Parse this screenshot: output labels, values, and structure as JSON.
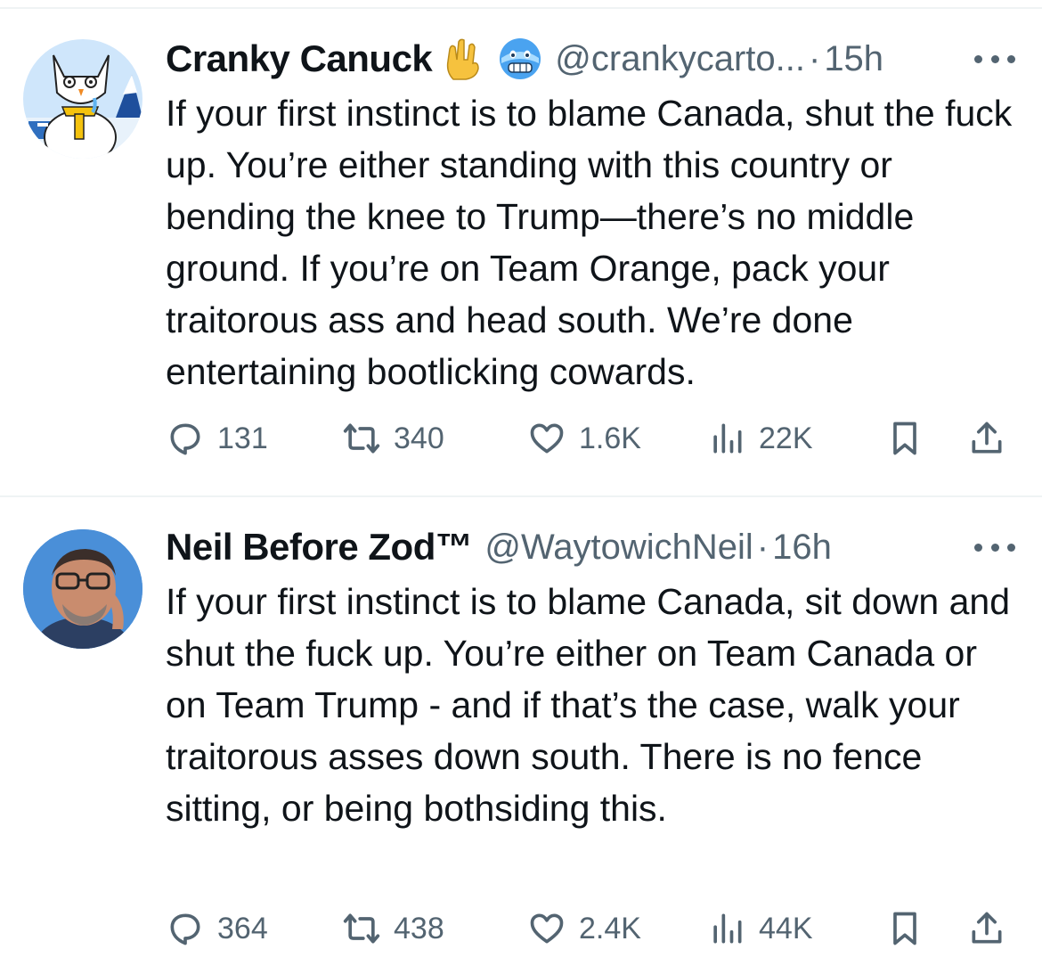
{
  "tweets": [
    {
      "name": "Cranky Canuck",
      "handle": "@crankycarto...",
      "separator": "·",
      "time": "15h",
      "emoji": [
        "rock-on-hand-icon",
        "freezing-face-icon"
      ],
      "avatar": "snowman-cartoon-avatar",
      "text": "If your first instinct is to blame Canada, shut the fuck up. You’re either standing with this country or bending the knee to Trump—there’s no middle ground. If you’re on Team Orange, pack your traitorous ass and head south. We’re done entertaining bootlicking cowards.",
      "replies": "131",
      "reposts": "340",
      "likes": "1.6K",
      "views": "22K"
    },
    {
      "name": "Neil Before Zod™",
      "handle": "@WaytowichNeil",
      "separator": "·",
      "time": "16h",
      "avatar": "man-with-glasses-avatar",
      "text": "If your first instinct is to blame  Canada, sit down and shut the fuck up. You’re either on Team Canada or on Team Trump - and if that’s the case, walk your traitorous asses down south. There is no fence sitting, or being bothsiding this.",
      "replies": "364",
      "reposts": "438",
      "likes": "2.4K",
      "views": "44K"
    }
  ],
  "colors": {
    "text": "#0f1419",
    "secondary": "#536471",
    "divider": "#eff3f4"
  }
}
